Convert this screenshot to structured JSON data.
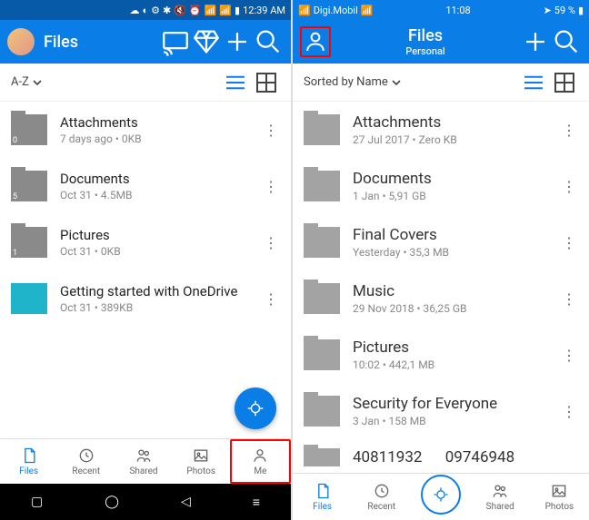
{
  "left": {
    "status_time": "12:39 AM",
    "title": "Files",
    "sort": "A-Z",
    "items": [
      {
        "name": "Attachments",
        "sub": "7 days ago • 0KB",
        "badge": "0"
      },
      {
        "name": "Documents",
        "sub": "Oct 31 • 4.5MB",
        "badge": "5"
      },
      {
        "name": "Pictures",
        "sub": "Oct 31 • 0KB",
        "badge": "1"
      },
      {
        "name": "Getting started with OneDrive",
        "sub": "Oct 31 • 389KB",
        "badge": ""
      }
    ],
    "tabs": [
      "Files",
      "Recent",
      "Shared",
      "Photos",
      "Me"
    ]
  },
  "right": {
    "carrier": "Digi.Mobil",
    "status_time": "11:08",
    "battery": "59 %",
    "title": "Files",
    "subtitle": "Personal",
    "sort": "Sorted by Name",
    "items": [
      {
        "name": "Attachments",
        "sub": "27 Jul 2017 • Zero KB"
      },
      {
        "name": "Documents",
        "sub": "1 Jan • 5,91 GB"
      },
      {
        "name": "Final Covers",
        "sub": "Yesterday • 35,3 MB"
      },
      {
        "name": "Music",
        "sub": "29 Nov 2018 • 36,25 GB"
      },
      {
        "name": "Pictures",
        "sub": "10:02 • 442,1 MB"
      },
      {
        "name": "Security for Everyone",
        "sub": "3 Jan • 158 MB"
      },
      {
        "name": "40811932      09746948",
        "sub": ""
      }
    ],
    "tabs": [
      "Files",
      "Recent",
      "",
      "Shared",
      "Photos"
    ]
  }
}
